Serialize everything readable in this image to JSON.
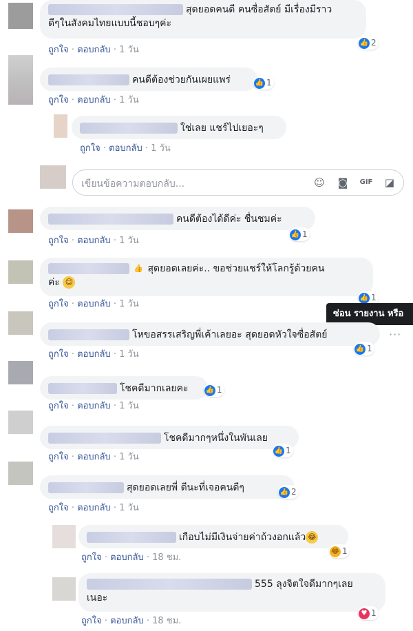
{
  "comments": [
    {
      "line1": "สุดยอดคนดี คนซื่อสัตย์ มีเรื่องมีราว",
      "line2": "ดีๆในสังคมไทยแบบนี้ชอบๆค่ะ",
      "reaction_count": "2",
      "time": "1 วัน"
    },
    {
      "text": "คนดีต้องช่วยกันเผยแพร่",
      "reaction_count": "1",
      "time": "1 วัน"
    },
    {
      "text": "ใช่เลย แชร์ไปเยอะๆ",
      "time": "1 วัน"
    },
    {
      "text": "คนดีต้องได้ดีค่ะ ชื่นชมค่ะ",
      "reaction_count": "1",
      "time": "1 วัน"
    },
    {
      "line1": "สุดยอดเลยค่ะ.. ขอช่วยแชร์ให้โลกรู้ด้วยคน",
      "line2": "ค่ะ",
      "reaction_count": "1",
      "time": "1 วัน"
    },
    {
      "text": "โหขอสรรเสริญพี่เค้าเลยอะ สุดยอดหัวใจซื่อสัตย์",
      "reaction_count": "1",
      "time": "1 วัน"
    },
    {
      "text": "โชคดีมากเลยคะ",
      "reaction_count": "1",
      "time": "1 วัน"
    },
    {
      "text": "โชคดีมากๆหนึ่งในพันเลย",
      "reaction_count": "1",
      "time": "1 วัน"
    },
    {
      "text": "สุดยอดเลยพี่ ดีนะที่เจอคนดีๆ",
      "reaction_count": "2",
      "time": "1 วัน"
    },
    {
      "text": "เกือบไม่มีเงินจ่ายค่าถ้วงอกแล้ว",
      "reaction_count": "1",
      "time": "18 ชม."
    },
    {
      "line1": "555 ลุงจิตใจดีมากๆเลย",
      "line2": "เนอะ",
      "reaction_count": "1",
      "time": "18 ชม."
    }
  ],
  "actions": {
    "like": "ถูกใจ",
    "reply": "ตอบกลับ",
    "separator": "·"
  },
  "reply_box": {
    "placeholder": "เขียนข้อความตอบกลับ..."
  },
  "tooltip": {
    "text": "ซ่อน รายงาน หรือ"
  },
  "more_menu": "···",
  "icons": {
    "like": "like-icon",
    "haha": "haha-icon",
    "love": "love-icon",
    "smile": "emoji-icon",
    "camera": "camera-icon",
    "gif": "gif-icon",
    "sticker": "sticker-icon"
  },
  "colors": {
    "bubble": "#f2f3f5",
    "link": "#385898",
    "like": "#1877f2",
    "love": "#e9345f",
    "tooltip": "#1c1e21"
  }
}
